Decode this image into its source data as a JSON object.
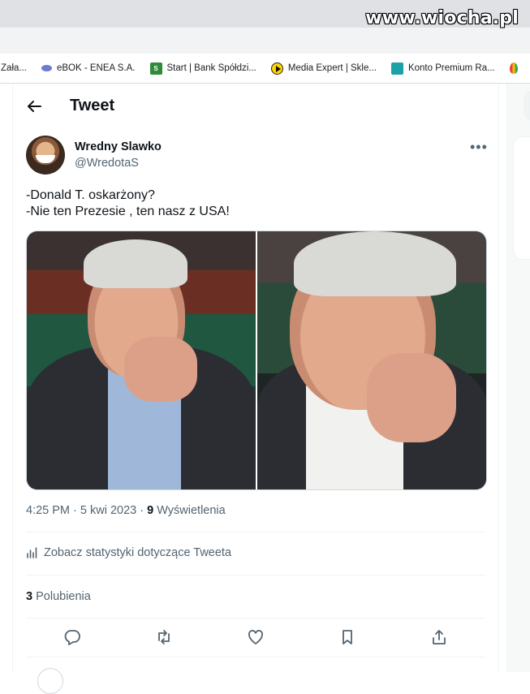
{
  "watermark": "www.wiocha.pl",
  "bookmarks": [
    {
      "label": "- Zała...",
      "icon": "page-icon"
    },
    {
      "label": "eBOK - ENEA S.A.",
      "icon": "enea-icon"
    },
    {
      "label": "Start | Bank Spółdzi...",
      "icon": "bank-icon"
    },
    {
      "label": "Media Expert | Skle...",
      "icon": "media-expert-icon"
    },
    {
      "label": "Konto Premium Ra...",
      "icon": "konto-icon"
    }
  ],
  "header": {
    "title": "Tweet"
  },
  "tweet": {
    "author_name": "Wredny Slawko",
    "author_handle": "@WredotaS",
    "text_lines": [
      "-Donald T. oskarżony?",
      "-Nie ten Prezesie , ten nasz z USA!"
    ],
    "time": "4:25 PM",
    "date": "5 kwi 2023",
    "views_count": "9",
    "views_label": "Wyświetlenia",
    "stats_link": "Zobacz statystyki dotyczące Tweeta",
    "likes_count": "3",
    "likes_label": "Polubienia"
  },
  "colors": {
    "text": "#0f1419",
    "secondary": "#536471",
    "border": "#eff3f4"
  }
}
